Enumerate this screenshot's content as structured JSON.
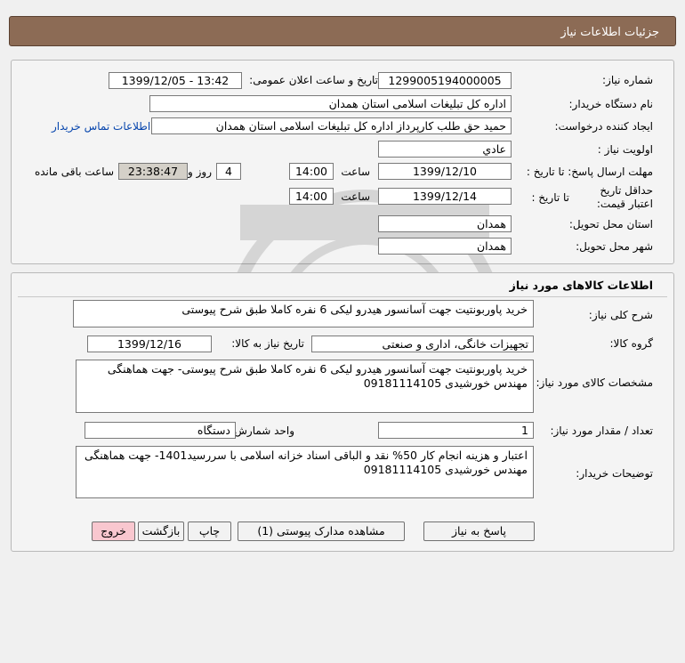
{
  "header": {
    "title": "جزئیات اطلاعات نیاز"
  },
  "need_info": {
    "need_number_label": "شماره نیاز:",
    "need_number": "1299005194000005",
    "announce_label": "تاریخ و ساعت اعلان عمومی:",
    "announce_value": "1399/12/05 - 13:42",
    "buyer_org_label": "نام دستگاه خریدار:",
    "buyer_org": "اداره کل تبلیغات اسلامی استان همدان",
    "requester_label": "ایجاد کننده درخواست:",
    "requester": "حمید  حق طلب کارپرداز اداره کل تبلیغات اسلامی استان همدان",
    "contact_link": "اطلاعات تماس خریدار",
    "priority_label": "اولویت نیاز :",
    "priority": "عادي",
    "deadline_label": "مهلت ارسال پاسخ:  تا تاریخ :",
    "deadline_date": "1399/12/10",
    "time_label": "ساعت",
    "deadline_time": "14:00",
    "days_value": "4",
    "days_label": "روز و",
    "remaining_time": "23:38:47",
    "remaining_label": "ساعت باقی مانده",
    "validity_label": "حداقل تاریخ اعتبار قیمت:",
    "validity_to_label": "تا تاریخ :",
    "validity_date": "1399/12/14",
    "validity_time": "14:00",
    "province_label": "استان محل تحویل:",
    "province": "همدان",
    "city_label": "شهر محل تحویل:",
    "city": "همدان"
  },
  "goods": {
    "section_title": "اطلاعات کالاهای مورد نیاز",
    "summary_label": "شرح کلی نیاز:",
    "summary": "خرید پاوربونتیت جهت آسانسور هیدرو لیکی 6 نفره کاملا طبق شرح پیوستی",
    "group_label": "گروه کالا:",
    "group": "تجهیزات خانگی، اداری و صنعتی",
    "need_date_label": "تاریخ نیاز به کالا:",
    "need_date": "1399/12/16",
    "specs_label": "مشخصات کالای مورد نیاز:",
    "specs": "خرید پاوربونتیت جهت آسانسور هیدرو لیکی 6 نفره کاملا طبق شرح پیوستی- جهت هماهنگی مهندس خورشیدی 09181114105",
    "qty_label": "تعداد / مقدار مورد نیاز:",
    "qty": "1",
    "unit_label": "واحد شمارش:",
    "unit": "دستگاه",
    "buyer_notes_label": "توضیحات خریدار:",
    "buyer_notes": "اعتبار و هزینه انجام کار 50% نقد و الباقی اسناد خزانه اسلامی با سررسید1401- جهت هماهنگی مهندس خورشیدی 09181114105"
  },
  "buttons": {
    "reply": "پاسخ به نیاز",
    "attachments": "مشاهده مدارک پیوستی (1)",
    "print": "چاپ",
    "back": "بازگشت",
    "exit": "خروج"
  },
  "colors": {
    "header_bg": "#8c6b55",
    "exit_bg": "#f9c7cf",
    "link": "#0645ad"
  }
}
